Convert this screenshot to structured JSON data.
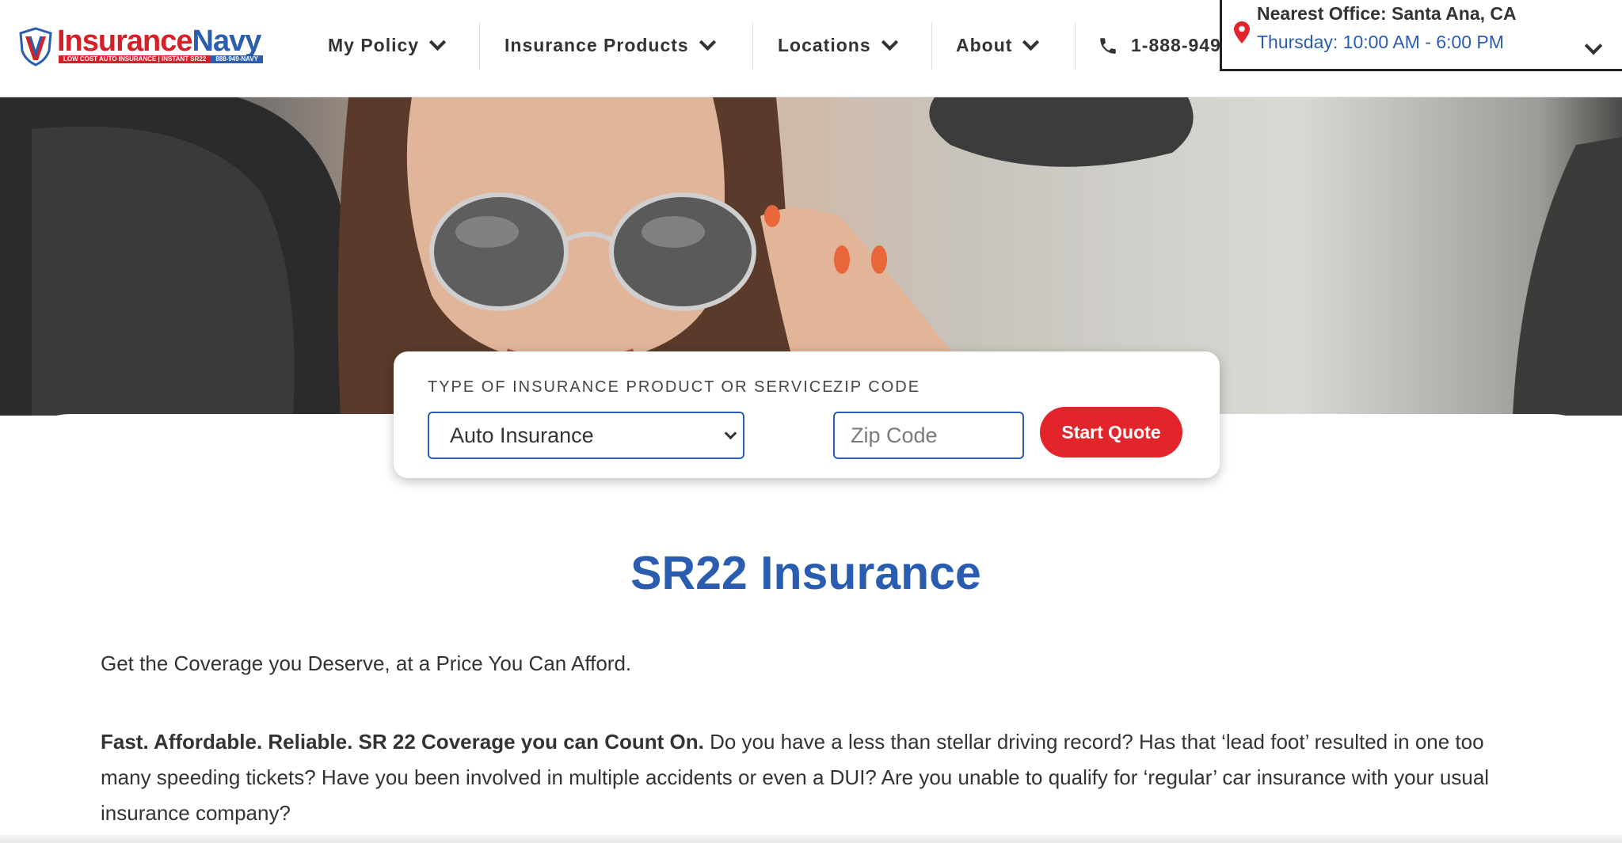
{
  "header": {
    "logo": {
      "brand_red": "Insurance",
      "brand_blue": "Navy",
      "tagline_red": "LOW COST AUTO INSURANCE | INSTANT SR22",
      "tagline_blue": "888-949-NAVY"
    },
    "nav": [
      {
        "label": "My Policy"
      },
      {
        "label": "Insurance Products"
      },
      {
        "label": "Locations"
      },
      {
        "label": "About"
      }
    ],
    "phone": "1-888-949",
    "office": {
      "title": "Nearest Office: Santa Ana, CA",
      "hours": "Thursday: 10:00 AM - 6:00 PM"
    }
  },
  "quote": {
    "type_label": "TYPE OF INSURANCE PRODUCT OR SERVICE",
    "type_value": "Auto Insurance",
    "zip_label": "ZIP CODE",
    "zip_placeholder": "Zip Code",
    "button": "Start Quote"
  },
  "content": {
    "title": "SR22 Insurance",
    "intro": "Get the Coverage you Deserve, at a Price You Can Afford.",
    "para_bold": "Fast. Affordable. Reliable. SR 22 Coverage you can Count On.",
    "para_text": " Do you have a less than stellar driving record? Has that ‘lead foot’ resulted in one too many speeding tickets? Have you been involved in multiple accidents or even a DUI? Are you unable to qualify for ‘regular’ car insurance with your usual insurance company?"
  },
  "colors": {
    "brand_blue": "#2a5db0",
    "brand_red": "#e2252b"
  }
}
